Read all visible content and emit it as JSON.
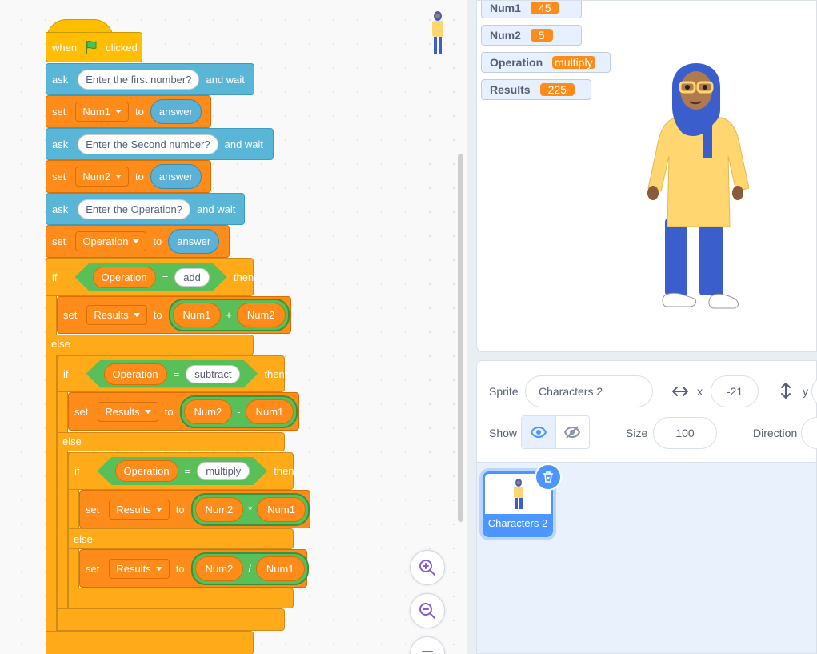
{
  "script": {
    "hat": {
      "when": "when",
      "clicked": "clicked"
    },
    "ask1": {
      "kw": "ask",
      "question": "Enter the first number?",
      "tail": "and wait"
    },
    "set1": {
      "kw": "set",
      "var": "Num1",
      "to": "to",
      "value": "answer"
    },
    "ask2": {
      "kw": "ask",
      "question": "Enter the Second number?",
      "tail": "and wait"
    },
    "set2": {
      "kw": "set",
      "var": "Num2",
      "to": "to",
      "value": "answer"
    },
    "ask3": {
      "kw": "ask",
      "question": "Enter the Operation?",
      "tail": "and wait"
    },
    "set3": {
      "kw": "set",
      "var": "Operation",
      "to": "to",
      "value": "answer"
    },
    "if1": {
      "kw": "if",
      "left": "Operation",
      "op": "=",
      "right": "add",
      "then": "then"
    },
    "set_add": {
      "kw": "set",
      "var": "Results",
      "to": "to",
      "a": "Num1",
      "op": "+",
      "b": "Num2"
    },
    "else1": "else",
    "if2": {
      "kw": "if",
      "left": "Operation",
      "op": "=",
      "right": "subtract",
      "then": "then"
    },
    "set_sub": {
      "kw": "set",
      "var": "Results",
      "to": "to",
      "a": "Num2",
      "op": "-",
      "b": "Num1"
    },
    "else2": "else",
    "if3": {
      "kw": "if",
      "left": "Operation",
      "op": "=",
      "right": "multiply",
      "then": "then"
    },
    "set_mul": {
      "kw": "set",
      "var": "Results",
      "to": "to",
      "a": "Num2",
      "op": "*",
      "b": "Num1"
    },
    "else3": "else",
    "set_div": {
      "kw": "set",
      "var": "Results",
      "to": "to",
      "a": "Num2",
      "op": "/",
      "b": "Num1"
    }
  },
  "monitors": [
    {
      "name": "Num1",
      "value": "45"
    },
    {
      "name": "Num2",
      "value": "5"
    },
    {
      "name": "Operation",
      "value": "multiply"
    },
    {
      "name": "Results",
      "value": "225"
    }
  ],
  "sprite_info": {
    "sprite_label": "Sprite",
    "sprite_name": "Characters 2",
    "x_label": "x",
    "x_value": "-21",
    "y_label": "y",
    "show_label": "Show",
    "size_label": "Size",
    "size_value": "100",
    "direction_label": "Direction"
  },
  "sprite_list": [
    {
      "name": "Characters 2"
    }
  ],
  "colors": {
    "looks": "#59b6d6",
    "variables": "#ff8c1a",
    "control": "#ffab19",
    "events": "#ffbf00",
    "operators": "#59c059"
  }
}
